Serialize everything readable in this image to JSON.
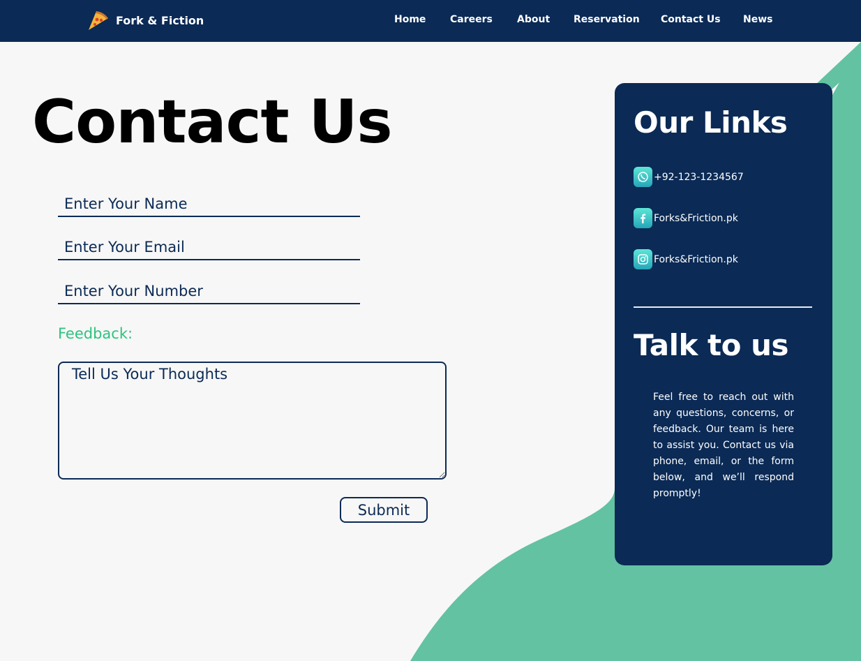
{
  "brand": {
    "name": "Fork & Fiction",
    "logo_icon": "pizza-slice-icon"
  },
  "nav": {
    "items": [
      {
        "label": "Home"
      },
      {
        "label": "Careers"
      },
      {
        "label": "About"
      },
      {
        "label": "Reservation"
      },
      {
        "label": "Contact Us"
      },
      {
        "label": "News"
      }
    ]
  },
  "colors": {
    "navy": "#0b2a55",
    "teal": "#63c2a2",
    "feedback_green": "#2ec27e",
    "background": "#f7f7f7"
  },
  "main": {
    "title": "Contact Us",
    "form": {
      "name_placeholder": "Enter Your Name",
      "email_placeholder": "Enter Your Email",
      "number_placeholder": "Enter Your Number",
      "feedback_label": "Feedback:",
      "thoughts_placeholder": "Tell Us Your Thoughts",
      "submit_label": "Submit"
    }
  },
  "sidebar": {
    "links_title": "Our Links",
    "links": [
      {
        "icon": "whatsapp-icon",
        "text": "+92-123-1234567"
      },
      {
        "icon": "facebook-icon",
        "text": "Forks&Friction.pk"
      },
      {
        "icon": "instagram-icon",
        "text": "Forks&Friction.pk"
      }
    ],
    "talk_title": "Talk to us",
    "talk_text": "Feel free to reach out with any questions, concerns, or feedback. Our team is here to assist you. Contact us via phone, email, or the form below, and we’ll respond promptly!"
  }
}
